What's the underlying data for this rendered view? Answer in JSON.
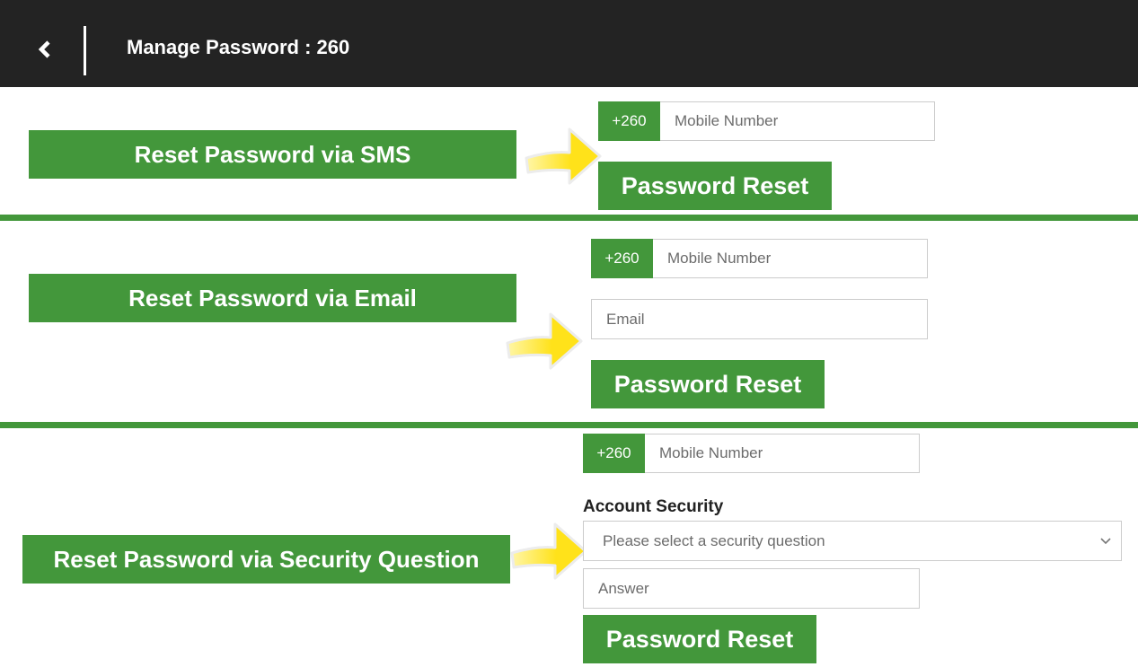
{
  "header": {
    "back_icon": "chevron-left-icon",
    "title": "Manage Password : 260"
  },
  "colors": {
    "header_bg": "#232323",
    "brand_green": "#43973b",
    "arrow_yellow": "#ffe21a"
  },
  "sections": [
    {
      "label": "Reset Password via SMS",
      "country_code": "+260",
      "mobile_placeholder": "Mobile Number",
      "button": "Password Reset"
    },
    {
      "label": "Reset Password via Email",
      "country_code": "+260",
      "mobile_placeholder": "Mobile Number",
      "email_placeholder": "Email",
      "button": "Password Reset"
    },
    {
      "label": "Reset Password via Security Question",
      "country_code": "+260",
      "mobile_placeholder": "Mobile Number",
      "security_label": "Account Security",
      "security_select": "Please select a security question",
      "answer_placeholder": "Answer",
      "button": "Password Reset"
    }
  ]
}
